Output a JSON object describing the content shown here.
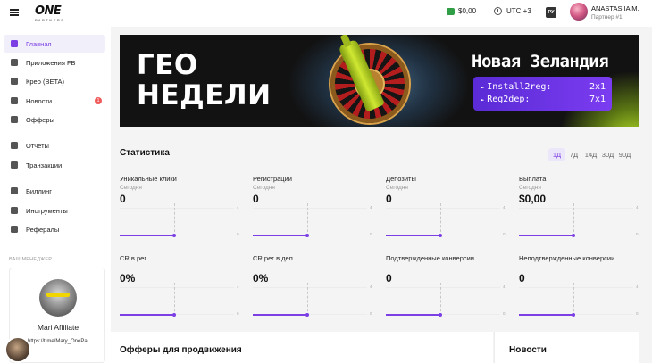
{
  "header": {
    "logo": "ONE",
    "logo_sub": "PARTNERS",
    "balance": "$0,00",
    "timezone": "UTC +3",
    "language": "РУ",
    "user_name": "ANASTASIIA M.",
    "user_role": "Партнер #1"
  },
  "sidebar": {
    "items": [
      {
        "label": "Главная",
        "icon": "dashboard-icon"
      },
      {
        "label": "Приложения FB",
        "icon": "apps-icon"
      },
      {
        "label": "Крео (BETA)",
        "icon": "creative-icon"
      },
      {
        "label": "Новости",
        "icon": "news-icon",
        "badge": "1"
      },
      {
        "label": "Офферы",
        "icon": "tag-icon"
      },
      {
        "label": "Отчеты",
        "icon": "reports-icon"
      },
      {
        "label": "Транзакции",
        "icon": "transactions-icon"
      },
      {
        "label": "Биллинг",
        "icon": "billing-icon"
      },
      {
        "label": "Инструменты",
        "icon": "tools-icon"
      },
      {
        "label": "Рефералы",
        "icon": "referrals-icon"
      }
    ],
    "manager_label": "ВАШ МЕНЕДЖЕР",
    "manager_name": "Mari Affiliate",
    "manager_link": "https://t.me/Mary_OnePa..."
  },
  "banner": {
    "title_line1": "ГЕО",
    "title_line2": "НЕДЕЛИ",
    "country": "Новая Зеландия",
    "offers": [
      {
        "name": "Install2reg:",
        "value": "2x1"
      },
      {
        "name": "Reg2dep:",
        "value": "7x1"
      }
    ]
  },
  "stats": {
    "title": "Статистика",
    "periods": [
      "1Д",
      "7Д",
      "14Д",
      "30Д",
      "90Д"
    ],
    "active_period": "1Д",
    "metrics": [
      {
        "label": "Уникальные клики",
        "period": "Сегодня",
        "value": "0",
        "tick_top": "4",
        "tick_bottom": "0"
      },
      {
        "label": "Регистрации",
        "period": "Сегодня",
        "value": "0",
        "tick_top": "4",
        "tick_bottom": "0"
      },
      {
        "label": "Депозиты",
        "period": "Сегодня",
        "value": "0",
        "tick_top": "4",
        "tick_bottom": "0"
      },
      {
        "label": "Выплата",
        "period": "Сегодня",
        "value": "$0,00",
        "tick_top": "4",
        "tick_bottom": "0"
      },
      {
        "label": "CR в рег",
        "period": "",
        "value": "0%",
        "tick_top": "4",
        "tick_bottom": "0"
      },
      {
        "label": "CR рег в деп",
        "period": "",
        "value": "0%",
        "tick_top": "4",
        "tick_bottom": "0"
      },
      {
        "label": "Подтвержденные конверсии",
        "period": "",
        "value": "0",
        "tick_top": "4",
        "tick_bottom": "0"
      },
      {
        "label": "Неподтвержденные конверсии",
        "period": "",
        "value": "0",
        "tick_top": "4",
        "tick_bottom": "0"
      }
    ]
  },
  "offers_section": {
    "title": "Офферы для продвижения"
  },
  "news_section": {
    "title": "Новости"
  },
  "colors": {
    "accent": "#7b3fe4",
    "banner_bg": "#121212",
    "badge": "#f05a5a"
  }
}
